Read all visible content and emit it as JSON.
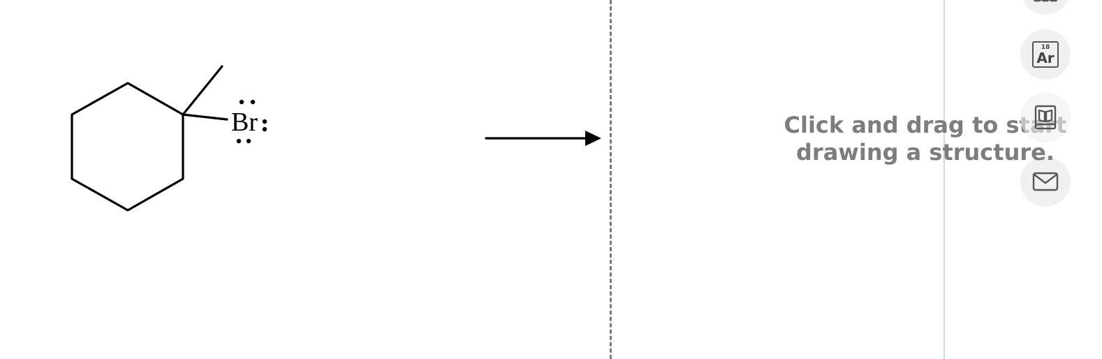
{
  "reactant": {
    "bromine_label": "Br",
    "bromine_lone_pairs": 3
  },
  "reaction_arrow": {
    "direction": "right"
  },
  "product_area": {
    "hint_line1": "Click and drag to start",
    "hint_line2": "drawing a structure."
  },
  "toolbar": {
    "periodic_table": {
      "number": "18",
      "symbol": "Ar"
    },
    "icons": [
      "grid-icon",
      "periodic-table-icon",
      "book-icon",
      "mail-icon"
    ]
  },
  "colors": {
    "bond": "#000000",
    "divider": "#7a7a7a",
    "hint_text": "#7d7d7d",
    "sidebar_line": "#cdd9db",
    "tool_button_bg": "#f0f0f0",
    "icon": "#555555"
  }
}
